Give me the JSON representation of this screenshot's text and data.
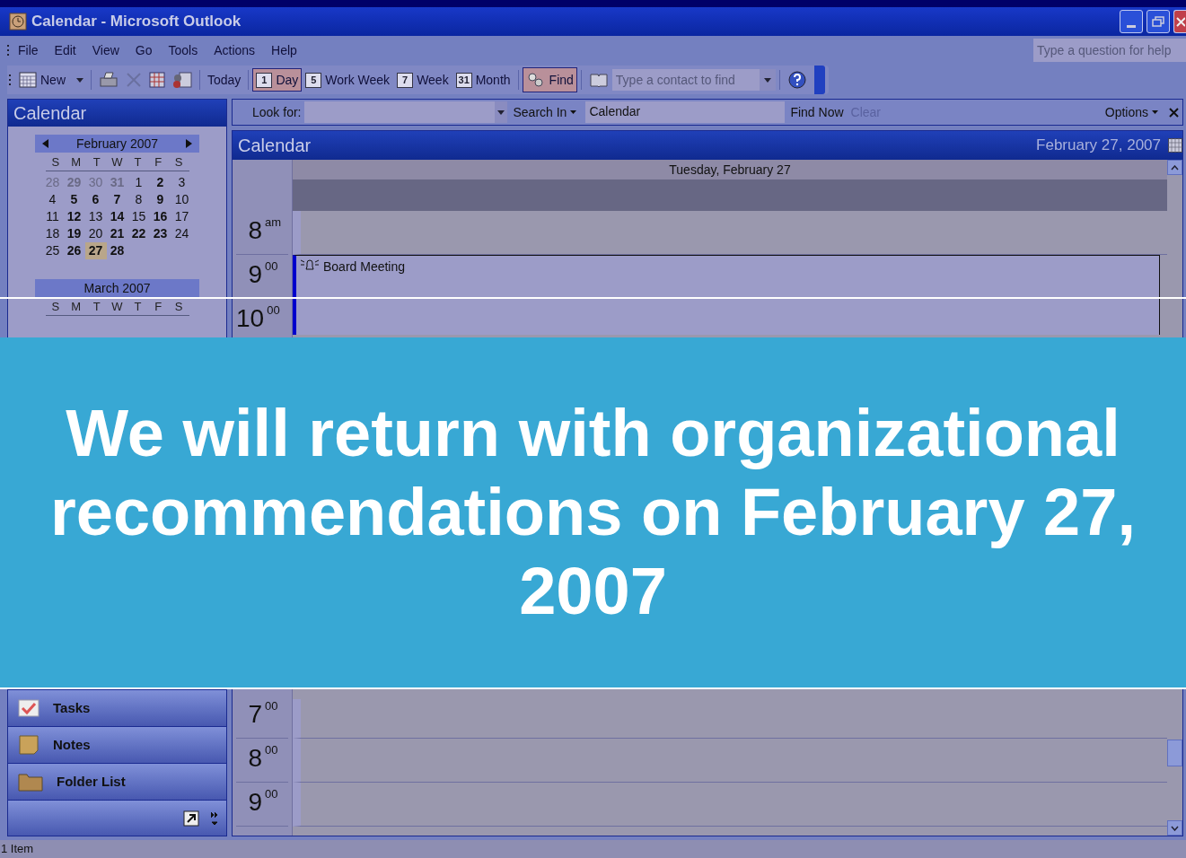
{
  "window": {
    "title": "Calendar - Microsoft Outlook"
  },
  "menu": [
    {
      "label": "File"
    },
    {
      "label": "Edit"
    },
    {
      "label": "View"
    },
    {
      "label": "Go"
    },
    {
      "label": "Tools"
    },
    {
      "label": "Actions"
    },
    {
      "label": "Help"
    }
  ],
  "help_box": {
    "placeholder": "Type a question for help"
  },
  "toolbar": [
    {
      "kind": "new",
      "label": "New"
    },
    {
      "kind": "sep"
    },
    {
      "kind": "print"
    },
    {
      "kind": "delete"
    },
    {
      "kind": "grid"
    },
    {
      "kind": "address"
    },
    {
      "kind": "sep"
    },
    {
      "kind": "text",
      "label": "Today"
    },
    {
      "kind": "sep"
    },
    {
      "kind": "view",
      "icon_text": "1",
      "label": "Day",
      "selected": true
    },
    {
      "kind": "view",
      "icon_text": "5",
      "label": "Work Week",
      "selected": false
    },
    {
      "kind": "view",
      "icon_text": "7",
      "label": "Week",
      "selected": false
    },
    {
      "kind": "view",
      "icon_text": "31",
      "label": "Month",
      "selected": false
    },
    {
      "kind": "sep"
    },
    {
      "kind": "find",
      "label": "Find",
      "selected": true
    },
    {
      "kind": "sep"
    },
    {
      "kind": "book"
    },
    {
      "kind": "contact",
      "placeholder": "Type a contact to find"
    },
    {
      "kind": "sep"
    },
    {
      "kind": "help"
    }
  ],
  "sidebar": {
    "title": "Calendar",
    "month": {
      "label": "February 2007",
      "weekdays": [
        "S",
        "M",
        "T",
        "W",
        "T",
        "F",
        "S"
      ],
      "weeks": [
        [
          {
            "day": "28",
            "other_month": true,
            "busy": false,
            "selected": false
          },
          {
            "day": "29",
            "other_month": true,
            "busy": true,
            "selected": false
          },
          {
            "day": "30",
            "other_month": true,
            "busy": false,
            "selected": false
          },
          {
            "day": "31",
            "other_month": true,
            "busy": true,
            "selected": false
          },
          {
            "day": "1",
            "other_month": false,
            "busy": false,
            "selected": false
          },
          {
            "day": "2",
            "other_month": false,
            "busy": true,
            "selected": false
          },
          {
            "day": "3",
            "other_month": false,
            "busy": false,
            "selected": false
          }
        ],
        [
          {
            "day": "4",
            "other_month": false,
            "busy": false,
            "selected": false
          },
          {
            "day": "5",
            "other_month": false,
            "busy": true,
            "selected": false
          },
          {
            "day": "6",
            "other_month": false,
            "busy": true,
            "selected": false
          },
          {
            "day": "7",
            "other_month": false,
            "busy": true,
            "selected": false
          },
          {
            "day": "8",
            "other_month": false,
            "busy": false,
            "selected": false
          },
          {
            "day": "9",
            "other_month": false,
            "busy": true,
            "selected": false
          },
          {
            "day": "10",
            "other_month": false,
            "busy": false,
            "selected": false
          }
        ],
        [
          {
            "day": "11",
            "other_month": false,
            "busy": false,
            "selected": false
          },
          {
            "day": "12",
            "other_month": false,
            "busy": true,
            "selected": false
          },
          {
            "day": "13",
            "other_month": false,
            "busy": false,
            "selected": false
          },
          {
            "day": "14",
            "other_month": false,
            "busy": true,
            "selected": false
          },
          {
            "day": "15",
            "other_month": false,
            "busy": false,
            "selected": false
          },
          {
            "day": "16",
            "other_month": false,
            "busy": true,
            "selected": false
          },
          {
            "day": "17",
            "other_month": false,
            "busy": false,
            "selected": false
          }
        ],
        [
          {
            "day": "18",
            "other_month": false,
            "busy": false,
            "selected": false
          },
          {
            "day": "19",
            "other_month": false,
            "busy": true,
            "selected": false
          },
          {
            "day": "20",
            "other_month": false,
            "busy": false,
            "selected": false
          },
          {
            "day": "21",
            "other_month": false,
            "busy": true,
            "selected": false
          },
          {
            "day": "22",
            "other_month": false,
            "busy": true,
            "selected": false
          },
          {
            "day": "23",
            "other_month": false,
            "busy": true,
            "selected": false
          },
          {
            "day": "24",
            "other_month": false,
            "busy": false,
            "selected": false
          }
        ],
        [
          {
            "day": "25",
            "other_month": false,
            "busy": false,
            "selected": false
          },
          {
            "day": "26",
            "other_month": false,
            "busy": true,
            "selected": false
          },
          {
            "day": "27",
            "other_month": false,
            "busy": true,
            "selected": true
          },
          {
            "day": "28",
            "other_month": false,
            "busy": true,
            "selected": false
          }
        ]
      ]
    },
    "next_month": {
      "label": "March 2007",
      "weekdays": [
        "S",
        "M",
        "T",
        "W",
        "T",
        "F",
        "S"
      ]
    },
    "nav_buttons": [
      {
        "kind": "tasks",
        "label": "Tasks"
      },
      {
        "kind": "notes",
        "label": "Notes"
      },
      {
        "kind": "folder",
        "label": "Folder List"
      }
    ]
  },
  "find_bar": {
    "look_for_label": "Look for:",
    "search_in": "Search In",
    "search_in_value": "Calendar",
    "find_now": "Find Now",
    "clear": "Clear",
    "clear_disabled": true,
    "options": "Options"
  },
  "calendar": {
    "title": "Calendar",
    "date": "February 27, 2007",
    "day_header": "Tuesday, February 27",
    "hours_top": [
      {
        "hour": "8",
        "suffix": "am"
      },
      {
        "hour": "9",
        "suffix": "00"
      },
      {
        "hour": "10",
        "suffix": "00"
      }
    ],
    "hours_bottom": [
      {
        "hour": "7",
        "suffix": "00"
      },
      {
        "hour": "8",
        "suffix": "00"
      },
      {
        "hour": "9",
        "suffix": "00"
      }
    ],
    "event": {
      "title": "Board Meeting",
      "reminder": true
    }
  },
  "overlay": {
    "caption": "We will return with organizational recommendations on February 27, 2007"
  },
  "status_bar": {
    "text": "1 Item"
  }
}
